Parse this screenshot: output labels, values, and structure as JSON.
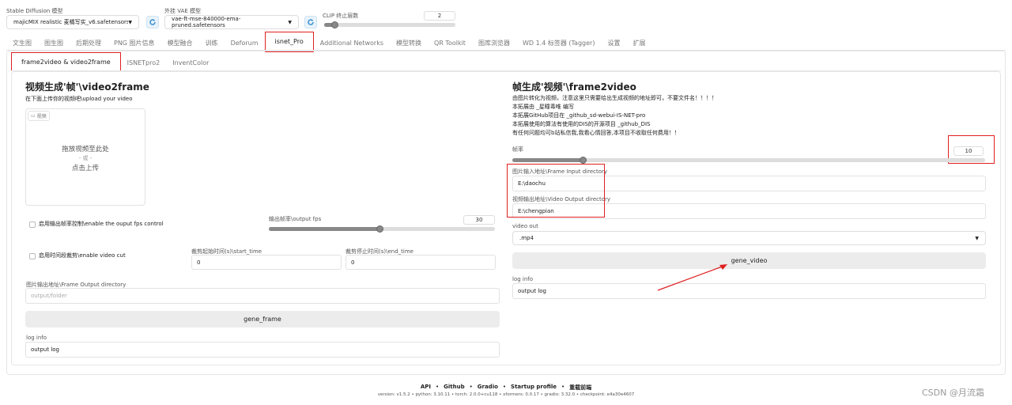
{
  "top": {
    "sd_label": "Stable Diffusion 模型",
    "sd_value": "majicMIX realistic 麦橘写实_v6.safetensors [e4a",
    "vae_label": "外挂 VAE 模型",
    "vae_value": "vae-ft-mse-840000-ema-pruned.safetensors",
    "clip_label": "CLIP 终止层数",
    "clip_value": "2",
    "clip_level": 0.08
  },
  "main_tabs": [
    "文生图",
    "图生图",
    "后期处理",
    "PNG 图片信息",
    "模型融合",
    "训练",
    "Deforum",
    "isnet_Pro",
    "Additional Networks",
    "模型转换",
    "QR Toolkit",
    "图库浏览器",
    "WD 1.4 标签器 (Tagger)",
    "设置",
    "扩展"
  ],
  "sub_tabs": [
    "frame2video & video2frame",
    "ISNETpro2",
    "InventColor"
  ],
  "left": {
    "title": "视频生成'帧'\\video2frame",
    "subtitle": "在下面上传你的视频吧\\upload your video",
    "video_tag": "视频",
    "drop_text": "拖放视频至此处",
    "or_text": "- 或 -",
    "click_text": "点击上传",
    "fps_check_label": "启用输出帧率控制\\enable the ouput fps control",
    "fps_label": "输出帧率\\output fps",
    "fps_value": "30",
    "fps_level": 0.49,
    "cut_check_label": "启用时间段裁剪\\enable video cut",
    "start_label": "裁剪起始时间(s)\\start_time",
    "start_value": "0",
    "end_label": "裁剪停止时间(s)\\end_time",
    "end_value": "0",
    "outdir_label": "图片输出地址\\Frame Output directory",
    "outdir_placeholder": "output/folder",
    "gene_btn": "gene_frame",
    "log_label": "log info",
    "log_value": "output log"
  },
  "right": {
    "title": "帧生成'视频'\\frame2video",
    "desc": [
      "由图片转化为视频，注意这里只需要给出生成视频的地址即可，不要文件名！！！！",
      "本拓展由 _星瞳毒唯 编写",
      "本拓展GitHub项目在 _github_sd-webui-IS-NET-pro",
      "本拓展使用的算法有使用的DIS的开源项目 _github_DIS",
      "有任何问题均可b站私信我,我看心情回答,本项目不收取任何费用！！"
    ],
    "fps_label": "帧率",
    "fps_value": "10",
    "fps_level": 0.15,
    "input_label": "图片输入地址\\Frame Input directory",
    "input_value": "E:\\daochu",
    "output_label": "视频输出地址\\Video Output directory",
    "output_value": "E:\\chengpian",
    "videoout_label": "video out",
    "videoout_value": ".mp4",
    "gene_btn": "gene_video",
    "log_label": "log info",
    "log_value": "output log"
  },
  "footer": {
    "links": [
      "API",
      "Github",
      "Gradio",
      "Startup profile",
      "重载前端"
    ],
    "sep": "•",
    "version": "version: v1.5.2  •  python: 3.10.11  •  torch: 2.0.0+cu118  •  xformers: 0.0.17  •  gradio: 3.32.0  •  checkpoint: e4a30e4607"
  },
  "watermark": "CSDN @月流霜"
}
